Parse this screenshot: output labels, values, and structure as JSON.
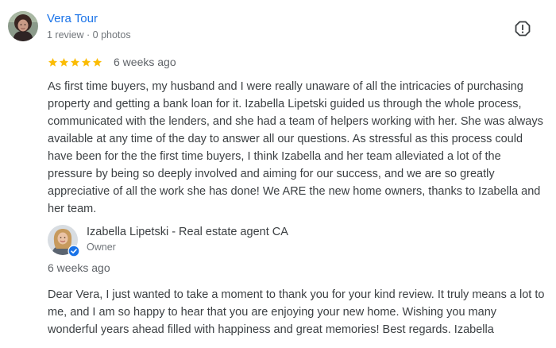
{
  "reviewer": {
    "name": "Vera Tour",
    "meta": "1 review · 0 photos",
    "avatar_icon": "profile-photo-icon"
  },
  "review": {
    "rating": 5,
    "max_rating": 5,
    "star_color": "#fbbc04",
    "date": "6 weeks ago",
    "text": "As first time buyers, my husband and I were really unaware of all the intricacies of purchasing property and getting a bank loan for it. Izabella Lipetski guided us through the whole process, communicated with the lenders, and she had a team of helpers working with her. She was always available at any time of the day to answer all our questions. As stressful as this process could have been for the the first time buyers, I think Izabella and her team alleviated a lot of the pressure by being so deeply involved and aiming for our success, and we are so greatly appreciative of all the work she has done! We ARE the new home owners, thanks to Izabella and her team."
  },
  "report_icon": "flag-report-icon",
  "owner_response": {
    "name": "Izabella Lipetski - Real estate agent CA",
    "role": "Owner",
    "date": "6 weeks ago",
    "verified_color": "#1a73e8",
    "text": "Dear Vera, I just wanted to take a moment to thank you for your kind review. It truly means a lot to me, and I am so happy to hear that you are enjoying your new home. Wishing you many wonderful years ahead filled with happiness and great memories! Best regards. Izabella"
  },
  "colors": {
    "link": "#1a73e8",
    "text": "#3c4043",
    "muted": "#70757a"
  }
}
